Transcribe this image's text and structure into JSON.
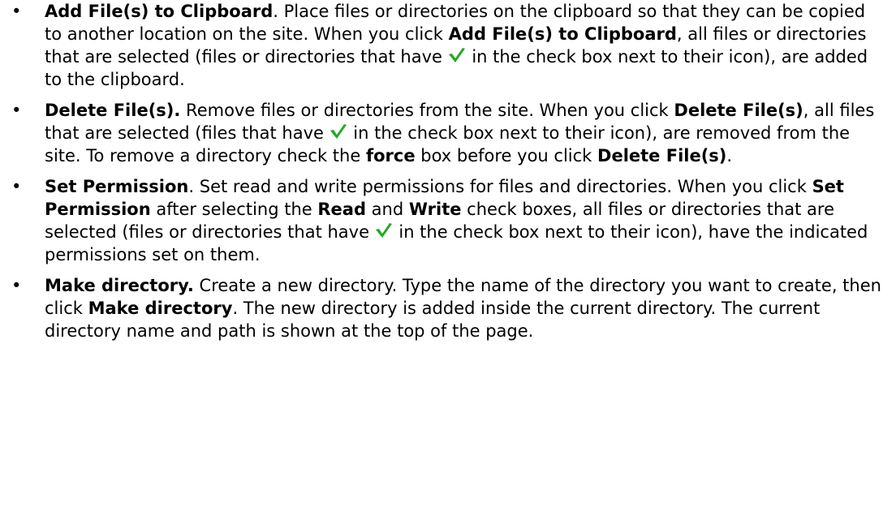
{
  "items": [
    {
      "bullet": "•",
      "title": "Add File(s) to Clipboard",
      "title_suffix": ".",
      "t1": " Place files or directories on the clipboard so that they can be copied to another location on the site. When you click ",
      "b1": "Add File(s) to Clipboard",
      "t2": ", all files or directories that are selected (files or directories that have ",
      "t3": " in the check box next to their icon), are added to the clipboard."
    },
    {
      "bullet": "•",
      "title": "Delete File(s).",
      "t1": " Remove files or directories from the site. When you click ",
      "b1": "Delete File(s)",
      "t2": ", all files that are selected (files that have ",
      "t3": " in the check box next to their icon), are removed from the site. To remove a directory check the ",
      "b2": "force",
      "t4": " box before you click ",
      "b3": "Delete File(s)",
      "t5": "."
    },
    {
      "bullet": "•",
      "title": "Set Permission",
      "title_suffix": ".",
      "t1": " Set read and write permissions for files and directories. When you click ",
      "b1": "Set Permission",
      "t2": " after selecting the ",
      "b2": "Read",
      "t3": " and ",
      "b3": "Write",
      "t4": " check boxes, all files or directories that are selected (files or directories that have ",
      "t5": " in the check box next to their icon), have the indicated permissions set on them."
    },
    {
      "bullet": "•",
      "title": "Make directory.",
      "t1": " Create a new directory. Type the name of the directory you want to create, then click ",
      "b1": "Make directory",
      "t2": ". The new directory is added inside the current directory. The current directory name and path is shown at the top of the page."
    }
  ],
  "icons": {
    "check": "green-checkmark-icon",
    "check_color": "#22aa22"
  }
}
